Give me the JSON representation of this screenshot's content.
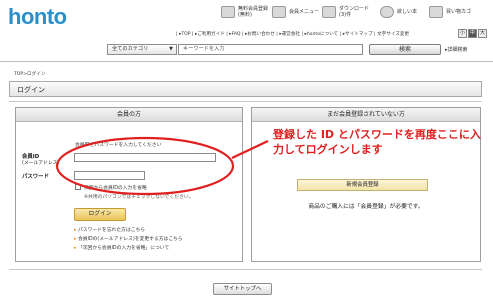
{
  "brand": {
    "logo": "honto"
  },
  "header_icons": [
    {
      "name": "free-trial",
      "label": "無料会員登録\n(無料)"
    },
    {
      "name": "member-menu",
      "label": "会員メニュー"
    },
    {
      "name": "download",
      "label": "ダウンロード\n(3)件"
    },
    {
      "name": "wishlist",
      "label": "欲しい本"
    },
    {
      "name": "cart",
      "label": "買い物カゴ"
    }
  ],
  "top_links": "| ▸TOP | ▸ご利用ガイド | ▸FAQ | ▸お問い合わせ | ▸運営会社 | ▸hontoについて | ▸サイトマップ | 文字サイズ変更",
  "font_size_buttons": [
    "小",
    "中",
    "大"
  ],
  "search": {
    "category": "全てのカテゴリ",
    "placeholder": "キーワードを入力",
    "button": "検索",
    "advanced": "▸詳細検索"
  },
  "breadcrumb": "TOP>ログイン",
  "page_title": "ログイン",
  "member_panel": {
    "title": "会員の方",
    "instruction": "会員IDとパスワードを入力してください",
    "id_label_1": "会員ID",
    "id_label_2": "(メールアドレス)",
    "password_label": "パスワード",
    "remember_label": "次回から会員IDの入力を省略",
    "remember_note": "※共用のパソコンではチェックしないでください。",
    "login_button": "ログイン",
    "links": [
      "パスワードを忘れた方はこちら",
      "会員IDの(メールアドレス)を変更する方はこちら",
      "「次回から会員IDの入力を省略」について"
    ]
  },
  "nonmember_panel": {
    "title": "まだ会員登録されていない方",
    "register_button": "新規会員登録",
    "note": "商品のご購入には「会員登録」が必要です。"
  },
  "site_top_button": "サイトトップへ",
  "annotation": "登録した ID とパスワードを再度ここに入力してログインします",
  "colors": {
    "annotation": "#e02020",
    "logo": "#2b8fc9"
  }
}
